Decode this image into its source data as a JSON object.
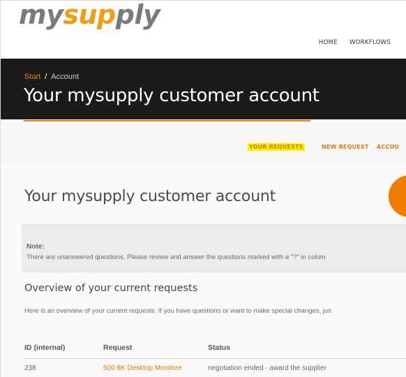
{
  "brand": {
    "logo_part1": "my",
    "logo_part2": "sup",
    "logo_part3": "ply"
  },
  "main_nav": {
    "items": [
      "HOME",
      "WORKFLOWS"
    ]
  },
  "breadcrumb": {
    "start": "Start",
    "separator": "/",
    "current": "Account"
  },
  "hero": {
    "title": "Your mysupply customer account"
  },
  "sub_nav": {
    "items": [
      "YOUR REQUESTS",
      "NEW REQUEST",
      "ACCOU"
    ],
    "active_index": 0
  },
  "page": {
    "title": "Your mysupply customer account"
  },
  "note": {
    "label": "Note:",
    "text": "There are unanswered questions. Please review and answer the questions marked with a \"?\" in colum"
  },
  "overview": {
    "title": "Overview of your current requests",
    "text": "Here is an overview of your current requests. If you have questions or want to make special changes, jus"
  },
  "requests_table": {
    "headers": [
      "ID (internal)",
      "Request",
      "Status"
    ],
    "rows": [
      [
        "238",
        "500 8K Desktop Monitore",
        "negotiation ended - award the supplier"
      ]
    ]
  },
  "colors": {
    "accent": "#f07d00",
    "hero_bg": "#1b1b1b",
    "highlight": "#f5f500"
  }
}
